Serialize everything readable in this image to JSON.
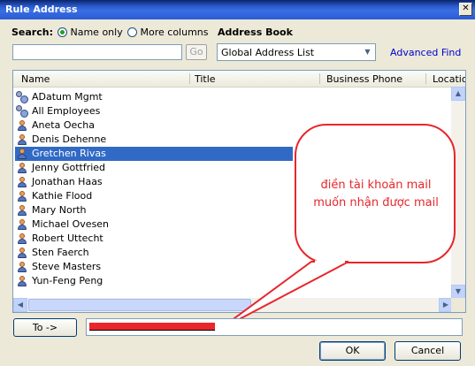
{
  "window": {
    "title": "Rule Address",
    "close_symbol": "✕"
  },
  "search": {
    "label": "Search:",
    "options": [
      {
        "label": "Name only",
        "selected": true
      },
      {
        "label": "More columns",
        "selected": false
      }
    ],
    "input_value": "",
    "go_label": "Go"
  },
  "address_book": {
    "label": "Address Book",
    "selected": "Global Address List",
    "advanced_find": "Advanced Find"
  },
  "list": {
    "columns": [
      "Name",
      "Title",
      "Business Phone",
      "Locatio"
    ],
    "rows": [
      {
        "name": "ADatum Mgmt",
        "icon": "group-icon",
        "selected": false
      },
      {
        "name": "All Employees",
        "icon": "group-icon",
        "selected": false
      },
      {
        "name": "Aneta Oecha",
        "icon": "person-icon",
        "selected": false
      },
      {
        "name": "Denis Dehenne",
        "icon": "person-icon",
        "selected": false
      },
      {
        "name": "Gretchen Rivas",
        "icon": "person-icon",
        "selected": true
      },
      {
        "name": "Jenny Gottfried",
        "icon": "person-icon",
        "selected": false
      },
      {
        "name": "Jonathan Haas",
        "icon": "person-icon",
        "selected": false
      },
      {
        "name": "Kathie Flood",
        "icon": "person-icon",
        "selected": false
      },
      {
        "name": "Mary North",
        "icon": "person-icon",
        "selected": false
      },
      {
        "name": "Michael Ovesen",
        "icon": "person-icon",
        "selected": false
      },
      {
        "name": "Robert Uttecht",
        "icon": "person-icon",
        "selected": false
      },
      {
        "name": "Sten Faerch",
        "icon": "person-icon",
        "selected": false
      },
      {
        "name": "Steve Masters",
        "icon": "person-icon",
        "selected": false
      },
      {
        "name": "Yun-Feng Peng",
        "icon": "person-icon",
        "selected": false
      }
    ]
  },
  "annotation": {
    "text_line1": "điền tài khoản mail",
    "text_line2": "muốn nhận được mail",
    "color": "#e8262b"
  },
  "to": {
    "button_label": "To ->",
    "value_redacted": true
  },
  "buttons": {
    "ok": "OK",
    "cancel": "Cancel"
  }
}
